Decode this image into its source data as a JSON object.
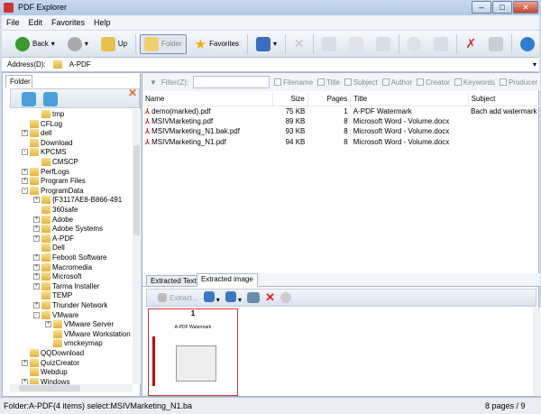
{
  "window": {
    "title": "PDF Explorer"
  },
  "menu": [
    "File",
    "Edit",
    "Favorites",
    "Help"
  ],
  "toolbar": {
    "back": "Back",
    "up": "Up",
    "folder": "Folder",
    "favorites": "Favorites"
  },
  "address": {
    "label": "Address(D):",
    "value": "A-PDF"
  },
  "left": {
    "tab": "Folder",
    "tree": [
      {
        "label": "tmp",
        "level": 2,
        "exp": ""
      },
      {
        "label": "CFLog",
        "level": 1,
        "exp": ""
      },
      {
        "label": "dell",
        "level": 1,
        "exp": "+"
      },
      {
        "label": "Download",
        "level": 1,
        "exp": ""
      },
      {
        "label": "KPCMS",
        "level": 1,
        "exp": "-"
      },
      {
        "label": "CMSCP",
        "level": 2,
        "exp": ""
      },
      {
        "label": "PerfLogs",
        "level": 1,
        "exp": "+"
      },
      {
        "label": "Program Files",
        "level": 1,
        "exp": "+"
      },
      {
        "label": "ProgramData",
        "level": 1,
        "exp": "-"
      },
      {
        "label": "{F3117AE8-B866-491",
        "level": 2,
        "exp": "+"
      },
      {
        "label": "360safe",
        "level": 2,
        "exp": ""
      },
      {
        "label": "Adobe",
        "level": 2,
        "exp": "+"
      },
      {
        "label": "Adobe Systems",
        "level": 2,
        "exp": "+"
      },
      {
        "label": "A-PDF",
        "level": 2,
        "exp": "+"
      },
      {
        "label": "Dell",
        "level": 2,
        "exp": ""
      },
      {
        "label": "Febooti Software",
        "level": 2,
        "exp": "+"
      },
      {
        "label": "Macromedia",
        "level": 2,
        "exp": "+"
      },
      {
        "label": "Microsoft",
        "level": 2,
        "exp": "+"
      },
      {
        "label": "Tarma Installer",
        "level": 2,
        "exp": "+"
      },
      {
        "label": "TEMP",
        "level": 2,
        "exp": ""
      },
      {
        "label": "Thunder Network",
        "level": 2,
        "exp": "+"
      },
      {
        "label": "VMware",
        "level": 2,
        "exp": "-"
      },
      {
        "label": "VMware Server",
        "level": 3,
        "exp": "+"
      },
      {
        "label": "VMware Workstation",
        "level": 3,
        "exp": ""
      },
      {
        "label": "vmckeymap",
        "level": 3,
        "exp": ""
      },
      {
        "label": "QQDownload",
        "level": 1,
        "exp": ""
      },
      {
        "label": "QuizCreator",
        "level": 1,
        "exp": "+"
      },
      {
        "label": "Webdup",
        "level": 1,
        "exp": ""
      },
      {
        "label": "Windows",
        "level": 1,
        "exp": "+"
      }
    ]
  },
  "filter": {
    "label": "Filter(Z):",
    "value": "",
    "fields": [
      "Filename",
      "Title",
      "Subject",
      "Author",
      "Creator",
      "Keywords",
      "Producer"
    ]
  },
  "list": {
    "columns": [
      "Name",
      "Size",
      "Pages",
      "Title",
      "Subject"
    ],
    "rows": [
      [
        "demo(marked).pdf",
        "75 KB",
        "1",
        "A-PDF Watermark",
        "Bach add watermark"
      ],
      [
        "MSIVMarketing.pdf",
        "89 KB",
        "8",
        "Microsoft Word - Volume.docx",
        ""
      ],
      [
        "MSIVMarketing_N1.bak.pdf",
        "93 KB",
        "8",
        "Microsoft Word - Volume.docx",
        ""
      ],
      [
        "MSIVMarketing_N1.pdf",
        "94 KB",
        "8",
        "Microsoft Word - Volume.docx",
        ""
      ]
    ]
  },
  "bottom": {
    "tabs": [
      "Extracted Text",
      "Extracted image"
    ],
    "extract": "Extract...",
    "thumb_page": "1",
    "thumb_title": "A-PDF Watermark"
  },
  "status": {
    "left": "Folder:A-PDF(4 items) select:MSIVMarketing_N1.ba",
    "right": "8 pages / 9"
  }
}
